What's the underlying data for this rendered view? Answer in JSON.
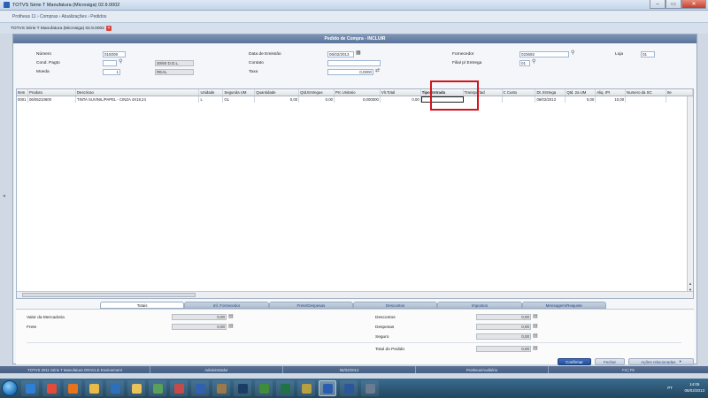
{
  "window": {
    "title": "TOTVS Série T Manufatura (Microsiga) 02.9.0002",
    "minimize": "‒",
    "maximize": "▭",
    "close": "✕"
  },
  "breadcrumb": "Protheus 11 › Compras › Atualizações › Pedidos",
  "tab": {
    "label": "TOTVS Série T Manufatura (Microsiga) 02.9.0002",
    "close": "×"
  },
  "dialog": {
    "title": "Pedido de Compra - INCLUIR",
    "fields": {
      "numero": {
        "label": "Número",
        "value": "015008"
      },
      "data_emissao": {
        "label": "Data de Emissão",
        "value": "06/02/2013"
      },
      "fornecedor": {
        "label": "Fornecedor",
        "value": "023692"
      },
      "loja": {
        "label": "Loja",
        "value": "01"
      },
      "cond_pagto": {
        "label": "Cond. Pagto",
        "value": "",
        "desc": "30/60 D.D.L."
      },
      "contato": {
        "label": "Contato",
        "value": ""
      },
      "filial_entrega": {
        "label": "Filial p/ Entrega",
        "value": "01"
      },
      "moeda": {
        "label": "Moeda",
        "value": "1",
        "desc": "REAL"
      },
      "taxa": {
        "label": "Taxa",
        "value": "0,0000"
      }
    }
  },
  "grid": {
    "columns": [
      "Item",
      "Produto",
      "Descricao",
      "Unidade",
      "Segunda UM",
      "Quantidade",
      "Qtd.Entregue",
      "Prc Unitario",
      "Vlr.Total",
      "Tipo Entrada",
      "Transportad",
      "C Custo",
      "Dt. Entrega",
      "Qtd. 2a UM",
      "Aliq. IPI",
      "Numero da SC",
      "Ite"
    ],
    "rows": [
      [
        "0001",
        "06/05210600",
        "TINTA SUVINIL/PAPEL - CINZA 4X18,24",
        "L",
        "GL",
        "0,00",
        "0,00",
        "0,000000",
        "0,00",
        "",
        "",
        "",
        "06/02/2013",
        "0,00",
        "10,00",
        "",
        ""
      ]
    ]
  },
  "bottom_tabs": [
    "Totais",
    "Inf. Fornecedor",
    "Frete/Despesas",
    "Descontos",
    "Impostos",
    "Mensagem/Reajuste"
  ],
  "totals": {
    "valor_mercadorias": {
      "label": "Valor da Mercadoria",
      "value": "0,00"
    },
    "frete": {
      "label": "Frete",
      "value": "0,00"
    },
    "descontos": {
      "label": "Descontos",
      "value": "0,00"
    },
    "despesas": {
      "label": "Despesas",
      "value": "0,00"
    },
    "seguro": {
      "label": "Seguro",
      "value": "0,00"
    },
    "total_pedido": {
      "label": "Total do Pedido",
      "value": "0,00"
    }
  },
  "buttons": {
    "confirmar": "Confirmar",
    "fechar": "Fechar",
    "acoes": "Ações relacionadas"
  },
  "status": [
    "TOTVS 2011 Série T Manufatura ORACLE Environment",
    "Administrador",
    "06/02/2013",
    "Protheus/Auditório",
    "F4 | F5"
  ],
  "taskbar": {
    "icons": [
      "ie",
      "chrome",
      "firefox",
      "explorer",
      "outlook",
      "folder",
      "network",
      "paint",
      "player",
      "tools",
      "ps",
      "dw",
      "excel",
      "mail",
      "totvs",
      "word",
      "calc"
    ],
    "time": "14:05",
    "date": "06/02/2013",
    "tray": "PT"
  }
}
